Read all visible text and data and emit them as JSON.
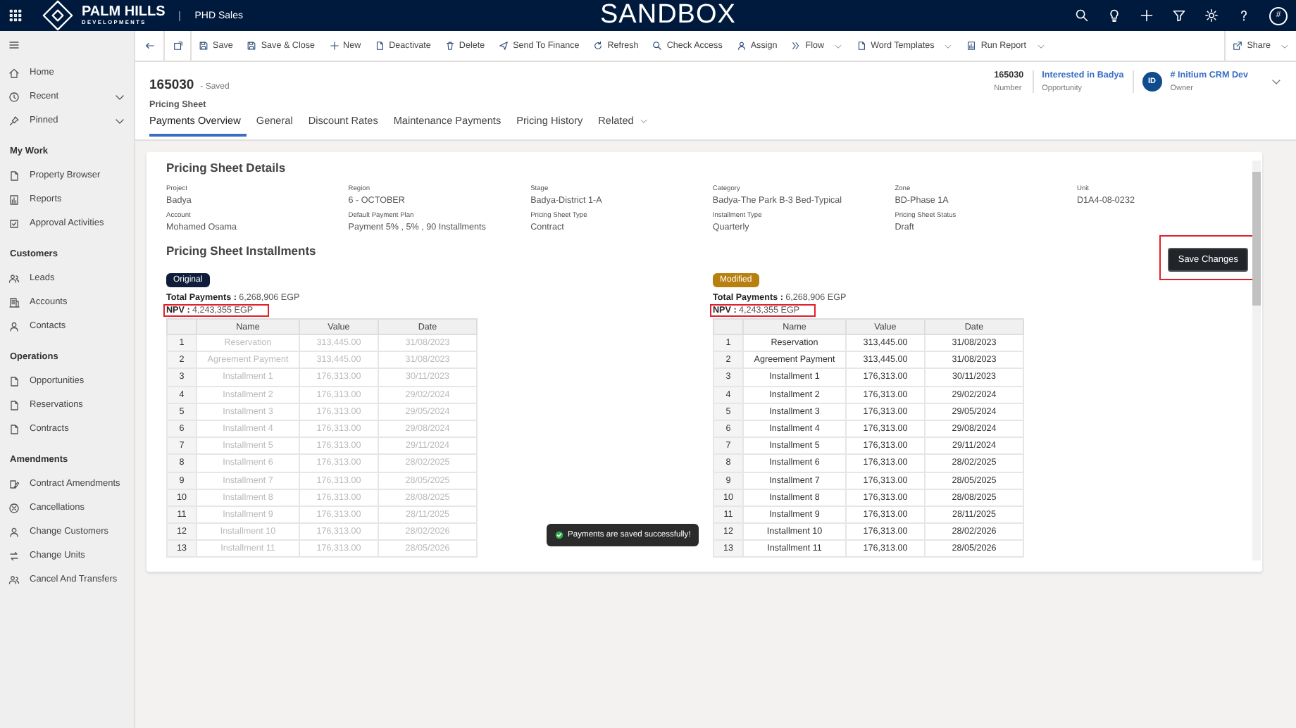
{
  "topbar": {
    "brand": "PALM HILLS",
    "brand_sub": "DEVELOPMENTS",
    "app_name": "PHD Sales",
    "environment": "SANDBOX",
    "avatar": "#"
  },
  "commands": [
    {
      "label": "Save",
      "dropdown": false
    },
    {
      "label": "Save & Close",
      "dropdown": false
    },
    {
      "label": "New",
      "dropdown": false
    },
    {
      "label": "Deactivate",
      "dropdown": false
    },
    {
      "label": "Delete",
      "dropdown": false
    },
    {
      "label": "Send To Finance",
      "dropdown": false
    },
    {
      "label": "Refresh",
      "dropdown": false
    },
    {
      "label": "Check Access",
      "dropdown": false
    },
    {
      "label": "Assign",
      "dropdown": false
    },
    {
      "label": "Flow",
      "dropdown": true
    },
    {
      "label": "Word Templates",
      "dropdown": true
    },
    {
      "label": "Run Report",
      "dropdown": true
    }
  ],
  "share": {
    "label": "Share",
    "dropdown": true
  },
  "sidebar": [
    {
      "items": [
        {
          "label": "Home",
          "expandable": false
        },
        {
          "label": "Recent",
          "expandable": true
        },
        {
          "label": "Pinned",
          "expandable": true
        }
      ]
    },
    {
      "heading": "My Work",
      "items": [
        {
          "label": "Property Browser",
          "expandable": false
        },
        {
          "label": "Reports",
          "expandable": false
        },
        {
          "label": "Approval Activities",
          "expandable": false
        }
      ]
    },
    {
      "heading": "Customers",
      "items": [
        {
          "label": "Leads",
          "expandable": false
        },
        {
          "label": "Accounts",
          "expandable": false
        },
        {
          "label": "Contacts",
          "expandable": false
        }
      ]
    },
    {
      "heading": "Operations",
      "items": [
        {
          "label": "Opportunities",
          "expandable": false
        },
        {
          "label": "Reservations",
          "expandable": false
        },
        {
          "label": "Contracts",
          "expandable": false
        }
      ]
    },
    {
      "heading": "Amendments",
      "items": [
        {
          "label": "Contract Amendments",
          "expandable": false
        },
        {
          "label": "Cancellations",
          "expandable": false
        },
        {
          "label": "Change Customers",
          "expandable": false
        },
        {
          "label": "Change Units",
          "expandable": false
        },
        {
          "label": "Cancel And Transfers",
          "expandable": false
        }
      ]
    }
  ],
  "record": {
    "id": "165030",
    "status": "- Saved",
    "entity": "Pricing Sheet",
    "header_fields": [
      {
        "value": "165030",
        "label": "Number",
        "link": false
      },
      {
        "value": "Interested in Badya",
        "label": "Opportunity",
        "link": true
      }
    ],
    "owner": {
      "initials": "ID",
      "name": "# Initium CRM Dev",
      "label": "Owner"
    }
  },
  "tabs": [
    {
      "label": "Payments Overview",
      "selected": true,
      "dropdown": false
    },
    {
      "label": "General",
      "selected": false,
      "dropdown": false
    },
    {
      "label": "Discount Rates",
      "selected": false,
      "dropdown": false
    },
    {
      "label": "Maintenance Payments",
      "selected": false,
      "dropdown": false
    },
    {
      "label": "Pricing History",
      "selected": false,
      "dropdown": false
    },
    {
      "label": "Related",
      "selected": false,
      "dropdown": true
    }
  ],
  "details": {
    "title": "Pricing Sheet Details",
    "fields": [
      {
        "label": "Project",
        "value": "Badya"
      },
      {
        "label": "Region",
        "value": "6 - OCTOBER"
      },
      {
        "label": "Stage",
        "value": "Badya-District 1-A"
      },
      {
        "label": "Category",
        "value": "Badya-The Park B-3 Bed-Typical"
      },
      {
        "label": "Zone",
        "value": "BD-Phase 1A"
      },
      {
        "label": "Unit",
        "value": "D1A4-08-0232"
      },
      {
        "label": "Account",
        "value": "Mohamed Osama"
      },
      {
        "label": "Default Payment Plan",
        "value": "Payment 5% , 5% , 90 Installments"
      },
      {
        "label": "Pricing Sheet Type",
        "value": "Contract"
      },
      {
        "label": "Installment Type",
        "value": "Quarterly"
      },
      {
        "label": "Pricing Sheet Status",
        "value": "Draft"
      }
    ]
  },
  "installments": {
    "title": "Pricing Sheet Installments",
    "save_button": "Save Changes",
    "panels": [
      {
        "badge": "Original",
        "color": "#0f1d3a",
        "disabled": true,
        "total": "**Total Payments :** 6,268,906 EGP",
        "npv": "**NPV :** 4,243,355 EGP",
        "columns": [
          "",
          "Name",
          "Value",
          "Date"
        ],
        "rows": [
          [
            "1",
            "Reservation",
            "313,445.00",
            "31/08/2023"
          ],
          [
            "2",
            "Agreement Payment",
            "313,445.00",
            "31/08/2023"
          ],
          [
            "3",
            "Installment 1",
            "176,313.00",
            "30/11/2023"
          ],
          [
            "4",
            "Installment 2",
            "176,313.00",
            "29/02/2024"
          ],
          [
            "5",
            "Installment 3",
            "176,313.00",
            "29/05/2024"
          ],
          [
            "6",
            "Installment 4",
            "176,313.00",
            "29/08/2024"
          ],
          [
            "7",
            "Installment 5",
            "176,313.00",
            "29/11/2024"
          ],
          [
            "8",
            "Installment 6",
            "176,313.00",
            "28/02/2025"
          ],
          [
            "9",
            "Installment 7",
            "176,313.00",
            "28/05/2025"
          ],
          [
            "10",
            "Installment 8",
            "176,313.00",
            "28/08/2025"
          ],
          [
            "11",
            "Installment 9",
            "176,313.00",
            "28/11/2025"
          ],
          [
            "12",
            "Installment 10",
            "176,313.00",
            "28/02/2026"
          ],
          [
            "13",
            "Installment 11",
            "176,313.00",
            "28/05/2026"
          ]
        ]
      },
      {
        "badge": "Modified",
        "color": "#b7800f",
        "disabled": false,
        "total": "**Total Payments :** 6,268,906 EGP",
        "npv": "**NPV :** 4,243,355 EGP",
        "columns": [
          "",
          "Name",
          "Value",
          "Date"
        ],
        "rows": [
          [
            "1",
            "Reservation",
            "313,445.00",
            "31/08/2023"
          ],
          [
            "2",
            "Agreement Payment",
            "313,445.00",
            "31/08/2023"
          ],
          [
            "3",
            "Installment 1",
            "176,313.00",
            "30/11/2023"
          ],
          [
            "4",
            "Installment 2",
            "176,313.00",
            "29/02/2024"
          ],
          [
            "5",
            "Installment 3",
            "176,313.00",
            "29/05/2024"
          ],
          [
            "6",
            "Installment 4",
            "176,313.00",
            "29/08/2024"
          ],
          [
            "7",
            "Installment 5",
            "176,313.00",
            "29/11/2024"
          ],
          [
            "8",
            "Installment 6",
            "176,313.00",
            "28/02/2025"
          ],
          [
            "9",
            "Installment 7",
            "176,313.00",
            "28/05/2025"
          ],
          [
            "10",
            "Installment 8",
            "176,313.00",
            "28/08/2025"
          ],
          [
            "11",
            "Installment 9",
            "176,313.00",
            "28/11/2025"
          ],
          [
            "12",
            "Installment 10",
            "176,313.00",
            "28/02/2026"
          ],
          [
            "13",
            "Installment 11",
            "176,313.00",
            "28/05/2026"
          ]
        ]
      }
    ]
  },
  "toast": {
    "message": "Payments are saved successfully!"
  }
}
